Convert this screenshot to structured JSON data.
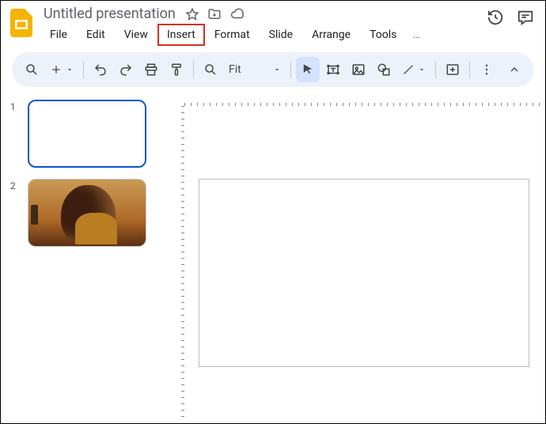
{
  "header": {
    "title": "Untitled presentation",
    "menu": {
      "file": "File",
      "edit": "Edit",
      "view": "View",
      "insert": "Insert",
      "format": "Format",
      "slide": "Slide",
      "arrange": "Arrange",
      "tools": "Tools",
      "more": "…"
    }
  },
  "toolbar": {
    "fit_label": "Fit"
  },
  "thumbs": {
    "n1": "1",
    "n2": "2"
  }
}
